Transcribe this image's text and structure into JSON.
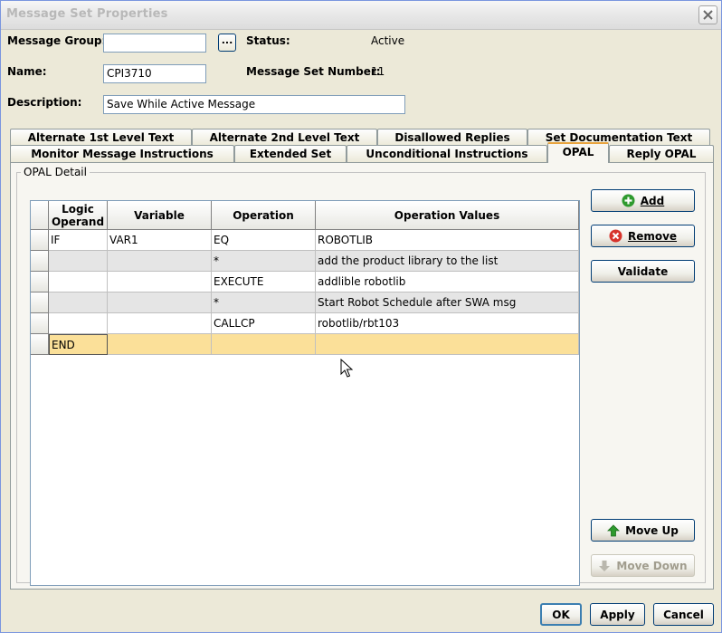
{
  "window": {
    "title": "Message Set Properties"
  },
  "form": {
    "message_group_label": "Message Group:",
    "message_group_value": "",
    "browse_label": "...",
    "status_label": "Status:",
    "status_value": "Active",
    "name_label": "Name:",
    "name_value": "CPI3710",
    "set_number_label": "Message Set Number:",
    "set_number_value": "11",
    "description_label": "Description:",
    "description_value": "Save While Active Message"
  },
  "tabs": {
    "row1": [
      "Alternate 1st Level Text",
      "Alternate 2nd Level Text",
      "Disallowed Replies",
      "Set Documentation Text"
    ],
    "row2": [
      "Monitor Message Instructions",
      "Extended Set",
      "Unconditional Instructions",
      "OPAL",
      "Reply OPAL"
    ],
    "active": "OPAL"
  },
  "opal": {
    "group_title": "OPAL Detail",
    "columns": [
      "Logic Operand",
      "Variable",
      "Operation",
      "Operation Values"
    ],
    "rows": [
      [
        "IF",
        "VAR1",
        "EQ",
        "ROBOTLIB"
      ],
      [
        "",
        "",
        "*",
        "add the product library to the list"
      ],
      [
        "",
        "",
        "EXECUTE",
        "addlible robotlib"
      ],
      [
        "",
        "",
        "*",
        "Start Robot Schedule after SWA msg"
      ],
      [
        "",
        "",
        "CALLCP",
        "robotlib/rbt103"
      ],
      [
        "END",
        "",
        "",
        ""
      ]
    ]
  },
  "side_buttons": {
    "add": "Add",
    "remove": "Remove",
    "validate": "Validate",
    "move_up": "Move Up",
    "move_down": "Move Down"
  },
  "footer": {
    "ok": "OK",
    "apply": "Apply",
    "cancel": "Cancel"
  },
  "colors": {
    "selected_row": "#fbe099",
    "alt_row": "#e5e5e5",
    "add_icon": "#2e9a2e",
    "remove_icon": "#d7332b"
  }
}
